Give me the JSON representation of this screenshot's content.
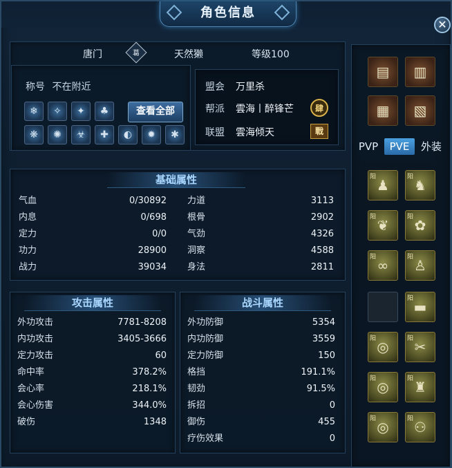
{
  "window": {
    "title": "角色信息",
    "close_label": "✕"
  },
  "header": {
    "menpai": "唐门",
    "menpai_icon": "葛",
    "name": "天然獭",
    "level": "等级100"
  },
  "title_row": {
    "label": "称号",
    "value": "不在附近"
  },
  "skills_button": "查看全部",
  "skills": [
    "❄",
    "✧",
    "✦",
    "♣",
    "❋",
    "✺",
    "☣",
    "✚",
    "◐",
    "✹",
    "✱"
  ],
  "guild": {
    "alliance_label": "盟会",
    "alliance_value": "万里杀",
    "faction_label": "帮派",
    "faction_value": "雲海丨醉锋芒",
    "faction_badge": "肆",
    "league_label": "联盟",
    "league_value": "雲海倾天",
    "league_badge": "戰"
  },
  "basic": {
    "title": "基础属性",
    "left": [
      {
        "k": "气血",
        "v": "0/30892"
      },
      {
        "k": "内息",
        "v": "0/698"
      },
      {
        "k": "定力",
        "v": "0/0"
      },
      {
        "k": "功力",
        "v": "28900"
      },
      {
        "k": "战力",
        "v": "39034"
      }
    ],
    "right": [
      {
        "k": "力道",
        "v": "3113"
      },
      {
        "k": "根骨",
        "v": "2902"
      },
      {
        "k": "气劲",
        "v": "4326"
      },
      {
        "k": "洞察",
        "v": "4588"
      },
      {
        "k": "身法",
        "v": "2811"
      }
    ]
  },
  "attack": {
    "title": "攻击属性",
    "rows": [
      {
        "k": "外功攻击",
        "v": "7781-8208"
      },
      {
        "k": "内功攻击",
        "v": "3405-3666"
      },
      {
        "k": "定力攻击",
        "v": "60"
      },
      {
        "k": "命中率",
        "v": "378.2%"
      },
      {
        "k": "会心率",
        "v": "218.1%"
      },
      {
        "k": "会心伤害",
        "v": "344.0%"
      },
      {
        "k": "破伤",
        "v": "1348"
      }
    ]
  },
  "combat": {
    "title": "战斗属性",
    "rows": [
      {
        "k": "外功防御",
        "v": "5354"
      },
      {
        "k": "内功防御",
        "v": "3559"
      },
      {
        "k": "定力防御",
        "v": "150"
      },
      {
        "k": "格挡",
        "v": "191.1%"
      },
      {
        "k": "韧劲",
        "v": "91.5%"
      },
      {
        "k": "拆招",
        "v": "0"
      },
      {
        "k": "御伤",
        "v": "455"
      },
      {
        "k": "疗伤效果",
        "v": "0"
      }
    ]
  },
  "tabs": {
    "pvp": "PVP",
    "pve": "PVE",
    "fashion": "外装"
  },
  "equipment": {
    "top": [
      "▤",
      "▥",
      "▦",
      "▧"
    ],
    "slots": [
      {
        "glyph": "♟",
        "mark": "阳"
      },
      {
        "glyph": "♞",
        "mark": "阳"
      },
      {
        "glyph": "❦",
        "mark": "阳"
      },
      {
        "glyph": "✿",
        "mark": "阳"
      },
      {
        "glyph": "∞",
        "mark": "阳"
      },
      {
        "glyph": "♙",
        "mark": "阳"
      },
      {
        "glyph": "",
        "mark": ""
      },
      {
        "glyph": "▬",
        "mark": "阳"
      },
      {
        "glyph": "◎",
        "mark": "阳"
      },
      {
        "glyph": "✂",
        "mark": "阳"
      },
      {
        "glyph": "◎",
        "mark": "阳"
      },
      {
        "glyph": "♜",
        "mark": "阳"
      },
      {
        "glyph": "◎",
        "mark": "阳"
      },
      {
        "glyph": "⚇",
        "mark": "阳"
      }
    ]
  }
}
